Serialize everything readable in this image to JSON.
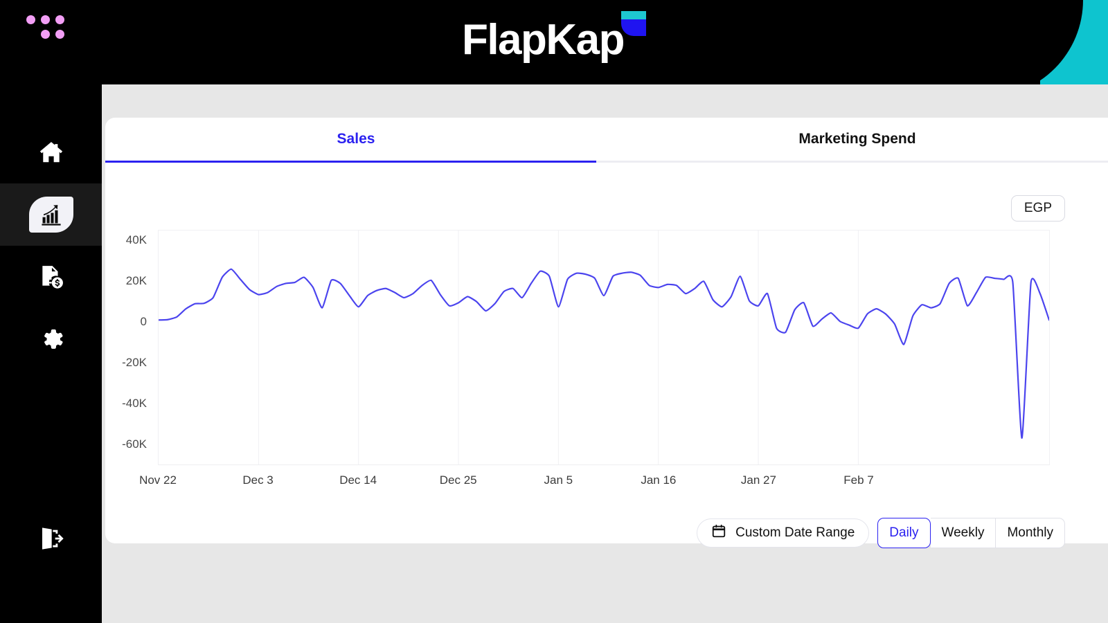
{
  "brand": {
    "name": "FlapKap",
    "logo_dots_color": "#f29ef5",
    "leaf_blue": "#1f14f0",
    "leaf_teal": "#1ec8d1"
  },
  "sidebar": {
    "items": [
      {
        "id": "home",
        "icon": "home-icon",
        "active": false
      },
      {
        "id": "analytics",
        "icon": "growth-chart-icon",
        "active": true
      },
      {
        "id": "invoices",
        "icon": "financial-report-icon",
        "active": false
      },
      {
        "id": "settings",
        "icon": "gear-icon",
        "active": false
      }
    ],
    "logout": {
      "id": "logout",
      "icon": "logout-icon"
    }
  },
  "tabs": [
    {
      "label": "Sales",
      "active": true
    },
    {
      "label": "Marketing Spend",
      "active": false
    }
  ],
  "currency": {
    "label": "EGP"
  },
  "controls": {
    "date_range_label": "Custom Date Range",
    "date_range_icon": "calendar-icon",
    "granularity": [
      {
        "label": "Daily",
        "active": true
      },
      {
        "label": "Weekly",
        "active": false
      },
      {
        "label": "Monthly",
        "active": false
      }
    ]
  },
  "colors": {
    "accent": "#2b21f0",
    "line": "#4b44ee",
    "sidebar_bg": "#000000",
    "page_bg": "#e7e7e7",
    "card_bg": "#ffffff",
    "grid": "#f0f0f3"
  },
  "chart_data": {
    "type": "line",
    "title": "Sales",
    "xlabel": "",
    "ylabel": "",
    "ylim": [
      -70000,
      45000
    ],
    "ytick_labels": [
      "40K",
      "20K",
      "0",
      "-20K",
      "-40K",
      "-60K"
    ],
    "ytick_values": [
      40000,
      20000,
      0,
      -20000,
      -40000,
      -60000
    ],
    "xtick_labels": [
      "Nov 22",
      "Dec 3",
      "Dec 14",
      "Dec 25",
      "Jan 5",
      "Jan 16",
      "Jan 27",
      "Feb 7"
    ],
    "xtick_indices": [
      0,
      11,
      22,
      33,
      44,
      55,
      66,
      77
    ],
    "grid": true,
    "legend": "none",
    "currency": "EGP",
    "series": [
      {
        "name": "Sales",
        "color": "#4b44ee",
        "values": [
          1000,
          1200,
          2500,
          6500,
          9000,
          9200,
          12000,
          22000,
          26000,
          21000,
          16000,
          13500,
          14500,
          17500,
          19000,
          19500,
          22000,
          17000,
          7000,
          20500,
          19000,
          13000,
          7500,
          13000,
          15500,
          16500,
          14500,
          12000,
          14000,
          18000,
          20500,
          13500,
          8000,
          9500,
          12500,
          10000,
          5500,
          9000,
          15000,
          16500,
          12000,
          19000,
          25000,
          22500,
          7500,
          21000,
          24000,
          23500,
          21500,
          13000,
          22500,
          24000,
          24500,
          23000,
          18000,
          17000,
          18500,
          18000,
          14000,
          16500,
          20000,
          11000,
          7500,
          12500,
          22500,
          10500,
          8000,
          14000,
          -3000,
          -5000,
          6000,
          9500,
          -2000,
          1500,
          4500,
          300,
          -1500,
          -3000,
          4000,
          6500,
          4000,
          -1000,
          -11000,
          3000,
          8500,
          7000,
          9000,
          19000,
          21500,
          8000,
          14500,
          22000,
          21500,
          21000,
          19500,
          -57000,
          19500,
          14000,
          1000
        ]
      }
    ]
  }
}
